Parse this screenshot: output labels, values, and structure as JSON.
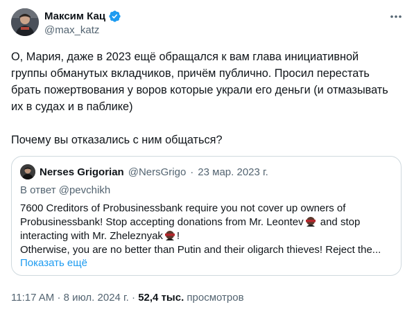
{
  "tweet": {
    "author_name": "Максим Кац",
    "author_handle": "@max_katz",
    "text_lines": [
      "О, Мария, даже в 2023 ещё обращался к вам глава инициативной",
      "группы обманутых вкладчиков, причём публично. Просил перестать",
      "брать пожертвования у воров которые украли его деньги (и отмазывать",
      "их в судах и в паблике)"
    ],
    "text_question": "Почему вы отказались с ним общаться?",
    "time": "11:17 AM",
    "sep": "·",
    "date": "8 июл. 2024 г.",
    "views_count": "52,4 тыс.",
    "views_label": "просмотров"
  },
  "quote": {
    "author_name": "Nerses Grigorian",
    "author_handle": "@NersGrigo",
    "sep": "·",
    "date": "23 мар. 2023 г.",
    "reply_to": "В ответ @pevchikh",
    "line1": "7600 Creditors of Probusinessbank require you not cover up owners of",
    "line2a": "Probusinessbank! Stop accepting donations from Mr. Leontev",
    "line2b": "and stop",
    "line3a": "interacting with Mr. Zheleznyak",
    "line3b": "!",
    "line4": "Otherwise, you are no better than Putin and their oligarch thieves! Reject the...",
    "show_more": "Показать ещё"
  },
  "colors": {
    "text": "#0f1419",
    "secondary": "#536471",
    "link": "#1d9bf0",
    "border": "#cfd9de",
    "verified": "#1d9bf0"
  }
}
